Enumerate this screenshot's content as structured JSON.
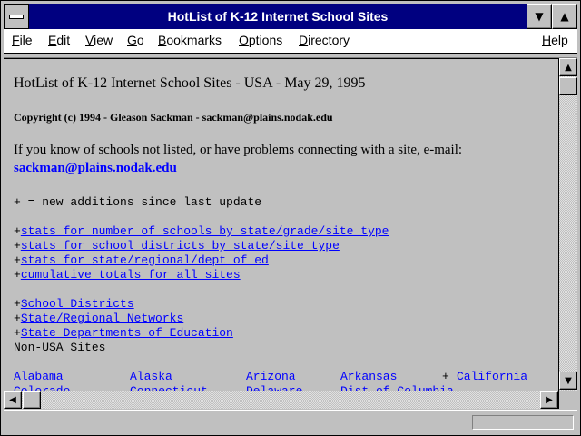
{
  "window": {
    "title": "HotList of K-12 Internet School Sites"
  },
  "menu": [
    {
      "first": "F",
      "rest": "ile"
    },
    {
      "first": "E",
      "rest": "dit"
    },
    {
      "first": "V",
      "rest": "iew"
    },
    {
      "first": "G",
      "rest": "o"
    },
    {
      "first": "B",
      "rest": "ookmarks"
    },
    {
      "first": "O",
      "rest": "ptions"
    },
    {
      "first": "D",
      "rest": "irectory"
    },
    {
      "first": "H",
      "rest": "elp"
    }
  ],
  "icons": {
    "system_menu": "system-menu-icon",
    "minimize": "▼",
    "maximize": "▲",
    "scroll_up": "▲",
    "scroll_down": "▼",
    "scroll_left": "◀",
    "scroll_right": "▶"
  },
  "page": {
    "title": "HotList of K-12 Internet School Sites - USA - May 29, 1995",
    "copyright": "Copyright (c) 1994 - Gleason Sackman - sackman@plains.nodak.edu",
    "intro": "If you know of schools not listed, or have problems connecting with a site, e-mail:",
    "email": "sackman@plains.nodak.edu",
    "legend": "+ = new additions since last update",
    "stats_links": [
      "stats for number of schools by state/grade/site type",
      "stats for school districts by state/site type",
      "stats for state/regional/dept of ed",
      "cumulative totals for all sites"
    ],
    "section_links": [
      "School Districts",
      "State/Regional Networks",
      "State Departments of Education"
    ],
    "non_usa": "Non-USA Sites",
    "states_row1": [
      "Alabama",
      "Alaska",
      "Arizona",
      "Arkansas",
      "California"
    ],
    "states_row2": [
      "Colorado",
      "Connecticut",
      "Delaware",
      "Dist of Columbia"
    ],
    "plus": "+"
  },
  "colors": {
    "titlebar": "#000080",
    "link": "#0000ff",
    "background": "#c0c0c0"
  }
}
